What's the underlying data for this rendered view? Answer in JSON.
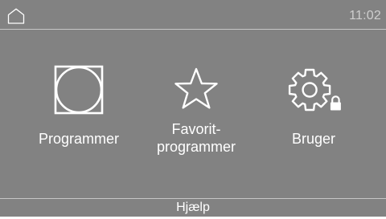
{
  "status_bar": {
    "home_icon": "home-icon",
    "time": "11:02"
  },
  "menu": {
    "tiles": [
      {
        "icon": "dryer-drum-icon",
        "label_lines": [
          "Programmer"
        ]
      },
      {
        "icon": "star-icon",
        "label_lines": [
          "Favorit-",
          "programmer"
        ]
      },
      {
        "icon": "gear-lock-icon",
        "label_lines": [
          "Bruger"
        ]
      }
    ]
  },
  "footer": {
    "help_label": "Hjælp"
  },
  "colors": {
    "screen_background": "#828282",
    "foreground": "#ffffff",
    "clock_text": "#cfcfcf",
    "divider": "#c6c6c6"
  }
}
